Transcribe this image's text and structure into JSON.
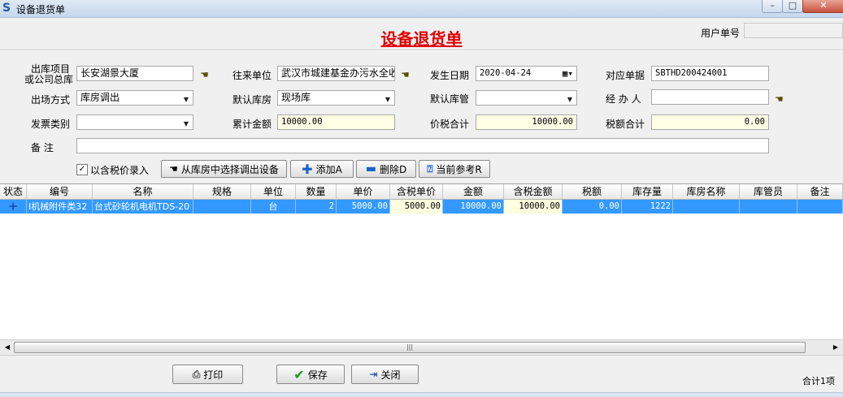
{
  "window": {
    "title": "设备退货单",
    "min": "–",
    "max": "□",
    "close": "✕"
  },
  "form_title": "设备退货单",
  "user_no": {
    "label": "用户单号",
    "value": ""
  },
  "fields": {
    "project_label_1": "出库项目",
    "project_label_2": "或公司总库",
    "project_value": "长安湖景大厦",
    "partner_label": "往来单位",
    "partner_value": "武汉市城建基金办污水全收",
    "date_label": "发生日期",
    "date_value": "2020-04-24",
    "doc_label": "对应单据",
    "doc_value": "SBTHD200424001",
    "exit_mode_label": "出场方式",
    "exit_mode_value": "库房调出",
    "default_wh_label": "默认库房",
    "default_wh_value": "现场库",
    "default_keeper_label": "默认库管",
    "default_keeper_value": "",
    "handler_label": "经 办 人",
    "handler_value": "",
    "invoice_label": "发票类别",
    "invoice_value": "",
    "total_amount_label": "累计金额",
    "total_amount_value": "10000.00",
    "tax_total_price_label": "价税合计",
    "tax_total_price_value": "10000.00",
    "tax_total_label": "税额合计",
    "tax_total_value": "0.00",
    "remark_label": "备    注",
    "remark_value": ""
  },
  "tax_checkbox": {
    "label": "以含税价录入",
    "checked": true
  },
  "buttons": {
    "select_from_wh": "从库房中选择调出设备",
    "add": "添加A",
    "delete": "删除D",
    "reference": "当前参考R",
    "print": "打印",
    "save": "保存",
    "close": "关闭"
  },
  "table": {
    "headers": [
      "状态",
      "编号",
      "名称",
      "规格",
      "单位",
      "数量",
      "单价",
      "含税单价",
      "金额",
      "含税金额",
      "税额",
      "库存量",
      "库房名称",
      "库管员",
      "备注"
    ],
    "rows": [
      {
        "status": "+",
        "code": "I机械附件类32",
        "name": "台式砂轮机电机TDS-20",
        "spec": "",
        "unit": "台",
        "qty": "2",
        "price": "5000.00",
        "tax_price": "5000.00",
        "amount": "10000.00",
        "tax_amount": "10000.00",
        "tax": "0.00",
        "stock": "1222",
        "wh_name": "",
        "keeper": "",
        "remark": ""
      }
    ]
  },
  "total_count": "合计1项"
}
